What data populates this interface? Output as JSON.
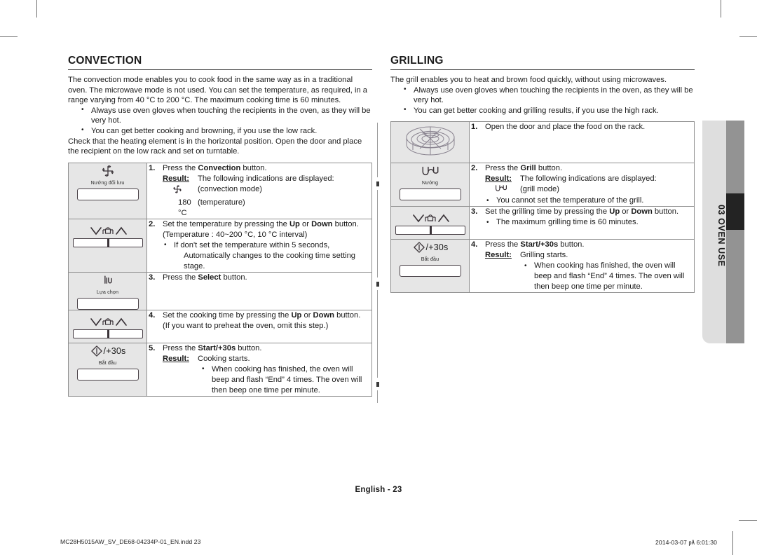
{
  "document": {
    "page_number_label": "English - 23",
    "footer_left": "MC28H5015AW_SV_DE68-04234P-01_EN.indd   23",
    "footer_right": "2014-03-07   ㎀ 6:01:30",
    "side_tab_label": "03 OVEN USE"
  },
  "convection": {
    "title": "CONVECTION",
    "intro": "The convection mode enables you to cook food in the same way as in a traditional oven. The microwave mode is not used. You can set the temperature, as required, in a range varying from 40 °C to 200 °C. The maximum cooking time is 60 minutes.",
    "bullets": [
      "Always use oven gloves when touching the recipients in the oven, as they will be very hot.",
      "You can get better cooking and browning, if you use the low rack."
    ],
    "outro": "Check that the heating element is in the horizontal position. Open the door and place the recipient on the low rack and set on turntable.",
    "steps": [
      {
        "num": "1.",
        "key_label_vn": "Nướng đối lưu",
        "key_icon": "fan-icon",
        "text_pre": "Press the ",
        "text_bold": "Convection",
        "text_post": " button.",
        "result_label": "Result:",
        "result_text": "The following indications are displayed:",
        "ind1_key": "fan-icon",
        "ind1_val": "(convection mode)",
        "ind2_key": "180 °C",
        "ind2_val": "(temperature)"
      },
      {
        "num": "2.",
        "key_icon": "up-down-lock-icon",
        "line1_pre": "Set the temperature by pressing the ",
        "line1_b1": "Up",
        "line1_mid": " or ",
        "line1_b2": "Down",
        "line1_post": " button.",
        "line2": "(Temperature : 40~200 °C, 10 °C interval)",
        "bullet1": "If don't set the temperature within 5 seconds,",
        "bullet1_cont": "Automatically changes to the cooking time setting stage."
      },
      {
        "num": "3.",
        "key_label_vn": "Lựa chọn",
        "key_icon": "select-icon",
        "text_pre": "Press the ",
        "text_bold": "Select",
        "text_post": " button."
      },
      {
        "num": "4.",
        "key_icon": "up-down-lock-icon",
        "line1_pre": "Set the cooking time by pressing the ",
        "line1_b1": "Up",
        "line1_mid": " or ",
        "line1_b2": "Down",
        "line1_post": " button.",
        "line2": "(If you want to preheat the oven, omit this step.)"
      },
      {
        "num": "5.",
        "key_label_vn": "Bắt đầu",
        "key_icon": "start-icon",
        "key_icon_text": "/+30s",
        "text_pre": "Press the ",
        "text_bold": "Start/+30s",
        "text_post": " button.",
        "result_label": "Result:",
        "result_text": "Cooking starts.",
        "bullet1": "When cooking has finished, the oven will",
        "bullet1_l2": "beep and flash “End” 4 times. The oven will",
        "bullet1_l3": "then beep one time per minute."
      }
    ]
  },
  "grilling": {
    "title": "GRILLING",
    "intro": "The grill enables you to heat and brown food quickly, without using microwaves.",
    "bullets": [
      "Always use oven gloves when touching the recipients in the oven, as they will be very hot.",
      "You can get better cooking and grilling results, if you use the high rack."
    ],
    "steps": [
      {
        "num": "1.",
        "key_icon": "turntable-high-rack-illustration",
        "text": "Open the door and place the food on the rack."
      },
      {
        "num": "2.",
        "key_label_vn": "Nướng",
        "key_icon": "grill-icon",
        "text_pre": "Press the ",
        "text_bold": "Grill",
        "text_post": " button.",
        "result_label": "Result:",
        "result_text": "The following indications are displayed:",
        "ind1_key": "grill-icon",
        "ind1_val": "(grill mode)",
        "bullet1": "You cannot set the temperature of the grill."
      },
      {
        "num": "3.",
        "key_icon": "up-down-lock-icon",
        "line1_pre": "Set the grilling time by pressing the ",
        "line1_b1": "Up",
        "line1_mid": " or ",
        "line1_b2": "Down",
        "line1_post": " button.",
        "bullet1": "The maximum grilling time is 60 minutes."
      },
      {
        "num": "4.",
        "key_label_vn": "Bắt đầu",
        "key_icon": "start-icon",
        "key_icon_text": "/+30s",
        "text_pre": "Press the ",
        "text_bold": "Start/+30s",
        "text_post": " button.",
        "result_label": "Result:",
        "result_text": "Grilling starts.",
        "bullet1": "When cooking has finished, the oven will",
        "bullet1_l2": "beep and flash “End” 4 times. The oven will",
        "bullet1_l3": "then beep one time per minute."
      }
    ]
  }
}
